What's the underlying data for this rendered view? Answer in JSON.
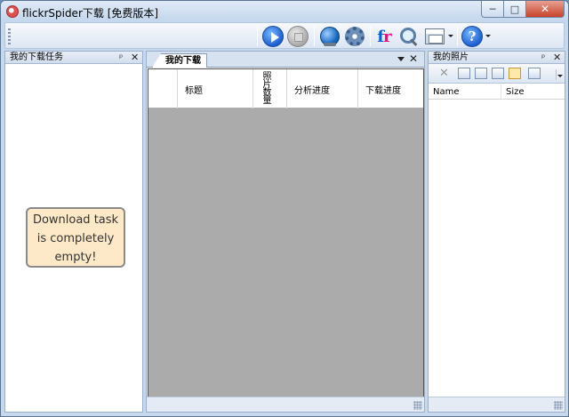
{
  "window": {
    "title": "flickrSpider下载 [免费版本]",
    "minimize_glyph": "─",
    "maximize_glyph": "□",
    "close_glyph": "✕"
  },
  "toolbar": {
    "buttons": [
      {
        "name": "start",
        "icon": "play-icon"
      },
      {
        "name": "stop",
        "icon": "stop-icon",
        "enabled": false
      },
      {
        "name": "web",
        "icon": "globe-icon"
      },
      {
        "name": "settings",
        "icon": "gear-icon"
      },
      {
        "name": "flickr",
        "icon": "flickr-icon",
        "glyph_a": "f",
        "glyph_b": "r"
      },
      {
        "name": "search",
        "icon": "search-icon"
      },
      {
        "name": "window-layout",
        "icon": "window-icon",
        "dropdown": true
      },
      {
        "name": "help",
        "icon": "help-icon",
        "glyph": "?",
        "dropdown": true
      }
    ]
  },
  "left_panel": {
    "title": "我的下载任务",
    "pin_glyph": "ᵖ",
    "close_glyph": "✕",
    "empty_message_lines": [
      "Download task",
      "is completely",
      "empty!"
    ]
  },
  "main_panel": {
    "tab_label": "我的下载",
    "close_glyph": "✕",
    "columns": [
      "",
      "标题",
      "照片数量",
      "分析进度",
      "下载进度"
    ]
  },
  "right_panel": {
    "title": "我的照片",
    "pin_glyph": "ᵖ",
    "close_glyph": "✕",
    "delete_glyph": "✕",
    "columns": [
      "Name",
      "Size"
    ]
  },
  "colors": {
    "frame": "#c6d8ec",
    "grid_background": "#ababab",
    "note_background": "#fde9c8",
    "accent_blue": "#1c5fd1"
  }
}
